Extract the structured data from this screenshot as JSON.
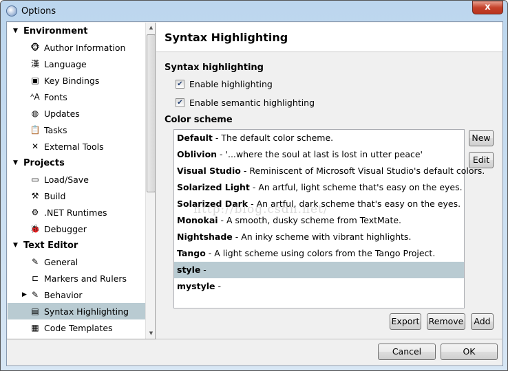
{
  "window": {
    "title": "Options",
    "close_label": "x"
  },
  "tree": [
    {
      "type": "category",
      "label": "Environment",
      "expanded": true
    },
    {
      "type": "item",
      "label": "Author Information",
      "icon": "monkey-icon",
      "glyph": "🐵"
    },
    {
      "type": "item",
      "label": "Language",
      "icon": "language-icon",
      "glyph": "漢"
    },
    {
      "type": "item",
      "label": "Key Bindings",
      "icon": "key-icon",
      "glyph": "▣"
    },
    {
      "type": "item",
      "label": "Fonts",
      "icon": "fonts-icon",
      "glyph": "ᴬA"
    },
    {
      "type": "item",
      "label": "Updates",
      "icon": "globe-icon",
      "glyph": "◍"
    },
    {
      "type": "item",
      "label": "Tasks",
      "icon": "clipboard-icon",
      "glyph": "📋"
    },
    {
      "type": "item",
      "label": "External Tools",
      "icon": "tools-icon",
      "glyph": "✕"
    },
    {
      "type": "category",
      "label": "Projects",
      "expanded": true
    },
    {
      "type": "item",
      "label": "Load/Save",
      "icon": "drive-icon",
      "glyph": "▭"
    },
    {
      "type": "item",
      "label": "Build",
      "icon": "hammer-icon",
      "glyph": "⚒"
    },
    {
      "type": "item",
      "label": ".NET Runtimes",
      "icon": "gear-icon",
      "glyph": "⚙"
    },
    {
      "type": "item",
      "label": "Debugger",
      "icon": "bug-icon",
      "glyph": "🐞"
    },
    {
      "type": "category",
      "label": "Text Editor",
      "expanded": true
    },
    {
      "type": "item",
      "label": "General",
      "icon": "notepad-icon",
      "glyph": "✎"
    },
    {
      "type": "item",
      "label": "Markers and Rulers",
      "icon": "ruler-icon",
      "glyph": "⊏"
    },
    {
      "type": "item",
      "label": "Behavior",
      "icon": "edit-icon",
      "glyph": "✎",
      "collapsed": true
    },
    {
      "type": "item",
      "label": "Syntax Highlighting",
      "icon": "syntax-icon",
      "glyph": "▤",
      "selected": true
    },
    {
      "type": "item",
      "label": "Code Templates",
      "icon": "template-icon",
      "glyph": "▦"
    }
  ],
  "panel": {
    "title": "Syntax Highlighting",
    "section1": "Syntax highlighting",
    "enable_highlighting": {
      "label": "Enable highlighting",
      "checked": true
    },
    "enable_semantic": {
      "label": "Enable semantic highlighting",
      "checked": true
    },
    "section2": "Color scheme",
    "schemes": [
      {
        "name": "Default",
        "desc": " - The default color scheme."
      },
      {
        "name": "Oblivion",
        "desc": " - '...where the soul at last is lost in utter peace'"
      },
      {
        "name": "Visual Studio",
        "desc": " - Reminiscent of Microsoft Visual Studio's default colors."
      },
      {
        "name": "Solarized Light",
        "desc": " - An artful, light scheme that's easy on the eyes."
      },
      {
        "name": "Solarized Dark",
        "desc": " - An artful, dark scheme that's easy on the eyes."
      },
      {
        "name": "Monokai",
        "desc": " - A smooth, dusky scheme from TextMate."
      },
      {
        "name": "Nightshade",
        "desc": " - An inky scheme with vibrant highlights."
      },
      {
        "name": "Tango",
        "desc": " - A light scheme using colors from the Tango Project."
      },
      {
        "name": "style",
        "desc": " -",
        "selected": true
      },
      {
        "name": "mystyle",
        "desc": " -"
      }
    ],
    "buttons": {
      "new": "New",
      "edit": "Edit",
      "export": "Export",
      "remove": "Remove",
      "add": "Add"
    }
  },
  "footer": {
    "cancel": "Cancel",
    "ok": "OK"
  },
  "watermark": "http://blog.csdn.net/",
  "colors": {
    "selection": "#b9cbd2",
    "close": "#c5432b"
  }
}
